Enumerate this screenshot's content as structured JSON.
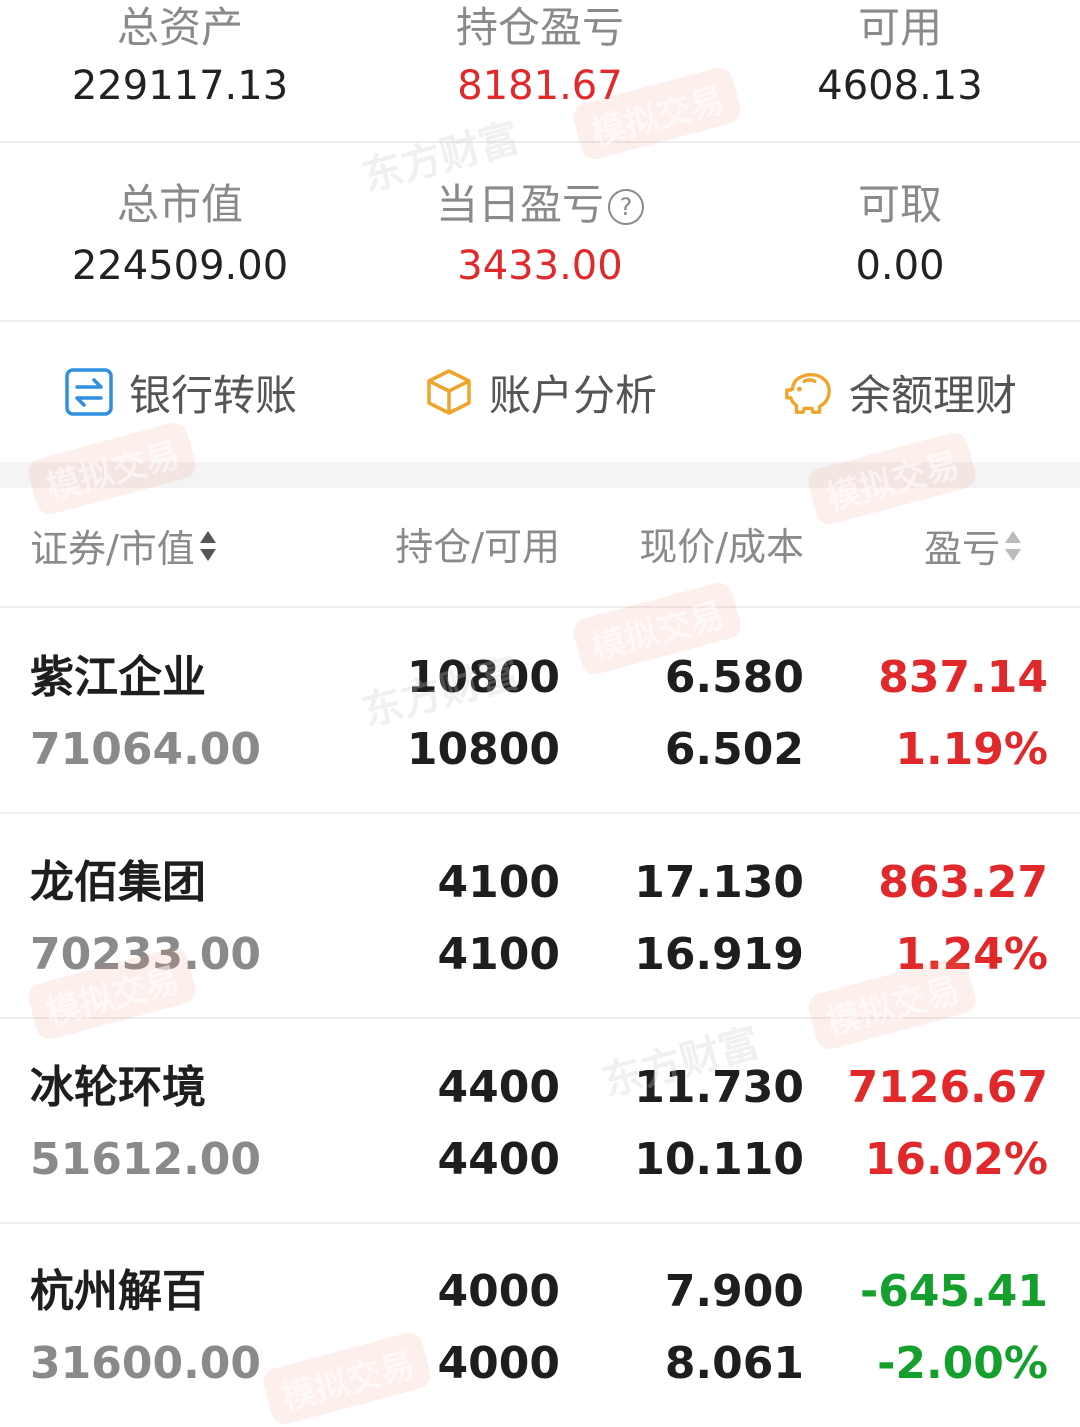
{
  "summary": {
    "total_assets_label": "总资产",
    "total_assets_value": "229117.13",
    "position_pl_label": "持仓盈亏",
    "position_pl_value": "8181.67",
    "available_label": "可用",
    "available_value": "4608.13",
    "market_value_label": "总市值",
    "market_value_value": "224509.00",
    "daily_pl_label": "当日盈亏",
    "daily_pl_value": "3433.00",
    "withdrawable_label": "可取",
    "withdrawable_value": "0.00",
    "help_glyph": "?"
  },
  "actions": [
    {
      "label": "银行转账",
      "icon": "bank-transfer-icon",
      "color": "#2f8fe0"
    },
    {
      "label": "账户分析",
      "icon": "cube-analysis-icon",
      "color": "#f0a42a"
    },
    {
      "label": "余额理财",
      "icon": "piggy-bank-icon",
      "color": "#f0a42a"
    }
  ],
  "table": {
    "col_security": "证券/市值",
    "col_position": "持仓/可用",
    "col_price": "现价/成本",
    "col_pl": "盈亏"
  },
  "positions": [
    {
      "name": "紫江企业",
      "market_value": "71064.00",
      "holding": "10800",
      "available": "10800",
      "price": "6.580",
      "cost": "6.502",
      "pl": "837.14",
      "pl_pct": "1.19%",
      "trend": "up"
    },
    {
      "name": "龙佰集团",
      "market_value": "70233.00",
      "holding": "4100",
      "available": "4100",
      "price": "17.130",
      "cost": "16.919",
      "pl": "863.27",
      "pl_pct": "1.24%",
      "trend": "up"
    },
    {
      "name": "冰轮环境",
      "market_value": "51612.00",
      "holding": "4400",
      "available": "4400",
      "price": "11.730",
      "cost": "10.110",
      "pl": "7126.67",
      "pl_pct": "16.02%",
      "trend": "up"
    },
    {
      "name": "杭州解百",
      "market_value": "31600.00",
      "holding": "4000",
      "available": "4000",
      "price": "7.900",
      "cost": "8.061",
      "pl": "-645.41",
      "pl_pct": "-2.00%",
      "trend": "down"
    }
  ],
  "watermark": {
    "brand": "东方财富",
    "badge": "模拟交易"
  },
  "colors": {
    "up": "#e1292b",
    "down": "#15a02e"
  }
}
